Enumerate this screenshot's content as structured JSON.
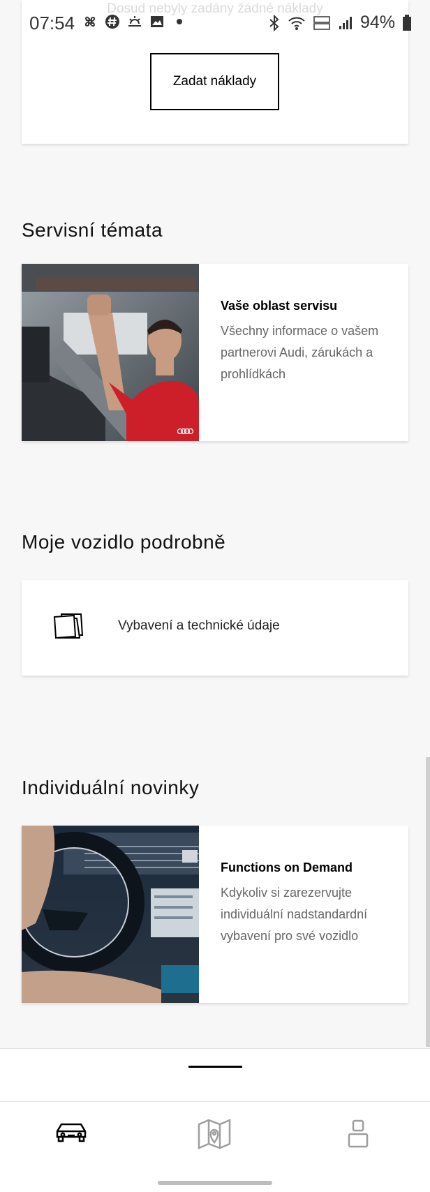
{
  "status_bar": {
    "time": "07:54",
    "battery": "94%",
    "left_icons": [
      "fan-icon",
      "hashtag-icon",
      "weather-icon",
      "image-icon",
      "dot-icon"
    ],
    "right_icons": [
      "bluetooth-icon",
      "wifi-icon",
      "volte-icon",
      "signal-icon",
      "battery-icon"
    ]
  },
  "ghost_text": "Dosud nebyly zadány žádné náklady",
  "costs": {
    "button_label": "Zadat náklady"
  },
  "service_section": {
    "title": "Servisní témata",
    "card_heading": "Vaše oblast servisu",
    "card_desc": "Všechny informace o vašem partnerovi Audi, zárukách a prohlídkách"
  },
  "vehicle_section": {
    "title": "Moje vozidlo podrobně",
    "item_label": "Vybavení a technické údaje",
    "item_icon": "documents-icon"
  },
  "news_section": {
    "title": "Individuální novinky",
    "card_heading": "Functions on Demand",
    "card_desc": "Kdykoliv si zarezervujte individuální nadstandardní vybavení pro své vozidlo"
  },
  "bottom_nav": {
    "tabs": [
      {
        "icon": "car-icon",
        "active": true
      },
      {
        "icon": "map-icon",
        "active": false
      },
      {
        "icon": "profile-icon",
        "active": false
      }
    ]
  },
  "colors": {
    "active_tab": "#000000",
    "inactive_tab": "#9e9e9e",
    "background": "#f7f7f7"
  }
}
